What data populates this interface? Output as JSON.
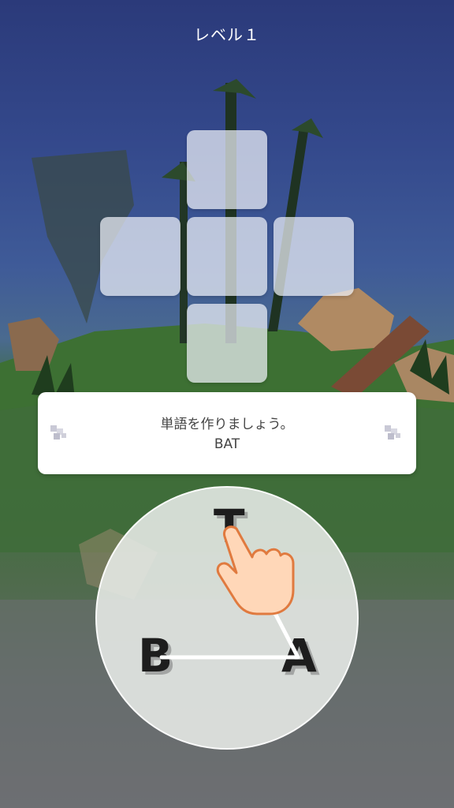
{
  "header": {
    "level_label": "レベル１"
  },
  "board": {
    "tiles": [
      "",
      "",
      "",
      "",
      ""
    ]
  },
  "hint": {
    "instruction": "単語を作りましょう。",
    "word": "BAT"
  },
  "wheel": {
    "letters": [
      "T",
      "B",
      "A"
    ],
    "path": [
      "B",
      "A",
      "T"
    ]
  },
  "colors": {
    "sky_top": "#2b3a7a",
    "grass": "#3e6d3c",
    "tile_fill": "#eef1f8",
    "panel_bg": "#ffffff",
    "letter_color": "#1d1d1d",
    "hand_skin": "#ffd7b8"
  },
  "icons": {
    "hint_left": "puzzle-piece-icon",
    "hint_right": "puzzle-piece-icon",
    "hand": "pointing-hand-icon"
  }
}
